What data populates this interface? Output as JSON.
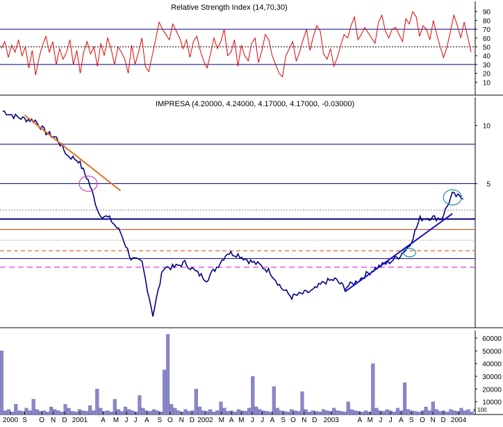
{
  "colors": {
    "background": "#ffffff",
    "panel_border": "#000000",
    "price_line": "#000080",
    "price_segment_alt": "#a05000",
    "rsi_line": "#e00000",
    "volume_fill": "#8888c8",
    "volume_edge": "#5050a0",
    "horizontal_line": "#000080",
    "orange_level": "#d04000",
    "magenta_level": "#e000e0",
    "downtrend": "#e07020",
    "uptrend": "#1010d0",
    "circle_pink": "#d040c0",
    "circle_teal": "#2090a0"
  },
  "chart_data": [
    {
      "type": "line",
      "panel": "rsi",
      "title": "Relative Strength Index (14,70,30)",
      "ylim": [
        0,
        100
      ],
      "yticks": [
        "10",
        "20",
        "30",
        "40",
        "50",
        "60",
        "70",
        "80",
        "90"
      ],
      "reference_lines": [
        {
          "y": 70,
          "style": "solid"
        },
        {
          "y": 50,
          "style": "dashed"
        },
        {
          "y": 30,
          "style": "solid"
        }
      ],
      "series": [
        {
          "values": [
            48,
            56,
            38,
            52,
            44,
            58,
            40,
            50,
            26,
            46,
            18,
            38,
            52,
            62,
            44,
            56,
            30,
            48,
            36,
            44,
            58,
            30,
            46,
            20,
            44,
            56,
            42,
            50,
            28,
            54,
            40,
            60,
            48,
            30,
            50,
            44,
            36,
            20,
            52,
            30,
            44,
            60,
            28,
            22,
            40,
            58,
            78,
            70,
            64,
            58,
            76,
            68,
            60,
            48,
            58,
            38,
            56,
            62,
            46,
            34,
            26,
            42,
            60,
            48,
            56,
            70,
            40,
            44,
            58,
            28,
            52,
            40,
            34,
            54,
            60,
            32,
            46,
            64,
            58,
            40,
            30,
            20,
            16,
            40,
            48,
            56,
            34,
            44,
            58,
            70,
            46,
            62,
            74,
            68,
            42,
            36,
            48,
            28,
            38,
            52,
            64,
            60,
            74,
            84,
            58,
            64,
            72,
            66,
            60,
            54,
            78,
            86,
            68,
            60,
            70,
            72,
            64,
            56,
            82,
            76,
            90,
            84,
            62,
            74,
            70,
            58,
            80,
            64,
            50,
            38,
            50,
            68,
            86,
            74,
            60,
            78,
            62,
            44
          ]
        }
      ]
    },
    {
      "type": "line",
      "panel": "price",
      "title": "IMPRESA (4.20000, 4.24000, 4.17000, 4.17000, -0.03000)",
      "scale": "log",
      "ylim": [
        0.9,
        14
      ],
      "yticks": [
        "5",
        "10"
      ],
      "series": [
        {
          "x": [
            "2000-07",
            "2000-08",
            "2000-09",
            "2000-10",
            "2000-11",
            "2000-12",
            "2001-01",
            "2001-02",
            "2001-03",
            "2001-04",
            "2001-05",
            "2001-06",
            "2001-07",
            "2001-08",
            "2001-09",
            "2001-10",
            "2001-11",
            "2001-12",
            "2002-01",
            "2002-02",
            "2002-03",
            "2002-04",
            "2002-05",
            "2002-06",
            "2002-07",
            "2002-08",
            "2002-09",
            "2002-10",
            "2002-11",
            "2002-12",
            "2003-01",
            "2003-02",
            "2003-03",
            "2003-04",
            "2003-05",
            "2003-06",
            "2003-07",
            "2003-08",
            "2003-09",
            "2003-10",
            "2003-11",
            "2003-12",
            "2004-01",
            "2004-02"
          ],
          "values": [
            11.9,
            11.2,
            10.8,
            10.6,
            9.2,
            8.6,
            7.0,
            6.6,
            5.2,
            3.5,
            3.3,
            2.8,
            2.05,
            1.95,
            1.05,
            1.85,
            1.85,
            1.95,
            1.75,
            1.6,
            1.85,
            2.2,
            2.15,
            2.0,
            1.9,
            1.75,
            1.45,
            1.3,
            1.35,
            1.4,
            1.55,
            1.6,
            1.45,
            1.55,
            1.7,
            1.85,
            1.95,
            2.1,
            2.4,
            3.3,
            3.35,
            3.3,
            4.4,
            4.17
          ]
        }
      ],
      "horizontal_levels": [
        8.0,
        5.0,
        3.65,
        3.28,
        2.9,
        2.55,
        2.25,
        2.05,
        1.85
      ],
      "annotations": [
        {
          "type": "downtrend_line",
          "from": [
            "2000-09",
            11.3
          ],
          "to": [
            "2001-06",
            4.6
          ]
        },
        {
          "type": "uptrend_line",
          "from": [
            "2003-03",
            1.38
          ],
          "to": [
            "2004-01",
            3.5
          ]
        },
        {
          "type": "circle",
          "at": [
            "2001-03",
            5.0
          ]
        },
        {
          "type": "circle",
          "at": [
            "2003-09",
            2.2
          ]
        },
        {
          "type": "circle",
          "at": [
            "2004-01",
            4.25
          ]
        }
      ]
    },
    {
      "type": "bar",
      "panel": "volume",
      "ylim": [
        0,
        66000
      ],
      "yticks": [
        "10000",
        "20000",
        "30000",
        "40000",
        "50000",
        "60000"
      ],
      "unit_label": "x 100",
      "values": [
        50000,
        3000,
        4000,
        2000,
        8000,
        3000,
        2500,
        5000,
        3000,
        12000,
        4000,
        2500,
        3000,
        2000,
        6000,
        4000,
        3000,
        2000,
        8000,
        5000,
        2500,
        2000,
        4000,
        3000,
        2500,
        7000,
        3000,
        20000,
        5000,
        2500,
        3000,
        2000,
        12000,
        4000,
        2500,
        6000,
        4000,
        3000,
        2000,
        15000,
        5000,
        3000,
        2500,
        4000,
        3000,
        2000,
        35000,
        63000,
        8000,
        5000,
        3000,
        2000,
        4000,
        2500,
        3000,
        20000,
        6000,
        3000,
        2500,
        4000,
        2000,
        3000,
        10000,
        5000,
        2500,
        3000,
        2000,
        4000,
        3000,
        2500,
        5000,
        30000,
        6000,
        4000,
        3000,
        2500,
        2000,
        22000,
        5000,
        3000,
        2500,
        2000,
        4000,
        3000,
        2500,
        18000,
        4000,
        2000,
        3000,
        2500,
        2000,
        4000,
        3000,
        2500,
        5000,
        3000,
        2500,
        2000,
        10000,
        4000,
        3000,
        2500,
        2000,
        3000,
        2000,
        40000,
        5000,
        3000,
        2500,
        4000,
        3000,
        2000,
        5000,
        3000,
        25000,
        4000,
        3000,
        2500,
        2000,
        3000,
        6000,
        3000,
        10000,
        4000,
        2500,
        3000,
        2000,
        4000,
        3000,
        2500,
        5000,
        3000,
        4000,
        2000
      ]
    }
  ],
  "x_axis": {
    "labels": [
      {
        "text": "2000",
        "pos": 0.022
      },
      {
        "text": "S",
        "pos": 0.052
      },
      {
        "text": "O",
        "pos": 0.088
      },
      {
        "text": "N",
        "pos": 0.112
      },
      {
        "text": "D",
        "pos": 0.136
      },
      {
        "text": "2001",
        "pos": 0.168
      },
      {
        "text": "A",
        "pos": 0.217
      },
      {
        "text": "M",
        "pos": 0.244
      },
      {
        "text": "J",
        "pos": 0.266
      },
      {
        "text": "J",
        "pos": 0.285
      },
      {
        "text": "A",
        "pos": 0.309
      },
      {
        "text": "S",
        "pos": 0.336
      },
      {
        "text": "O",
        "pos": 0.358
      },
      {
        "text": "N",
        "pos": 0.382
      },
      {
        "text": "D",
        "pos": 0.404
      },
      {
        "text": "2002",
        "pos": 0.432
      },
      {
        "text": "M",
        "pos": 0.466
      },
      {
        "text": "A",
        "pos": 0.487
      },
      {
        "text": "M",
        "pos": 0.508
      },
      {
        "text": "J",
        "pos": 0.531
      },
      {
        "text": "J",
        "pos": 0.552
      },
      {
        "text": "A",
        "pos": 0.573
      },
      {
        "text": "S",
        "pos": 0.596
      },
      {
        "text": "O",
        "pos": 0.617
      },
      {
        "text": "N",
        "pos": 0.64
      },
      {
        "text": "D",
        "pos": 0.662
      },
      {
        "text": "2003",
        "pos": 0.697
      },
      {
        "text": "A",
        "pos": 0.757
      },
      {
        "text": "M",
        "pos": 0.779
      },
      {
        "text": "J",
        "pos": 0.801
      },
      {
        "text": "J",
        "pos": 0.822
      },
      {
        "text": "A",
        "pos": 0.844
      },
      {
        "text": "S",
        "pos": 0.866
      },
      {
        "text": "O",
        "pos": 0.889
      },
      {
        "text": "N",
        "pos": 0.911
      },
      {
        "text": "D",
        "pos": 0.933
      },
      {
        "text": "2004",
        "pos": 0.965
      }
    ]
  }
}
